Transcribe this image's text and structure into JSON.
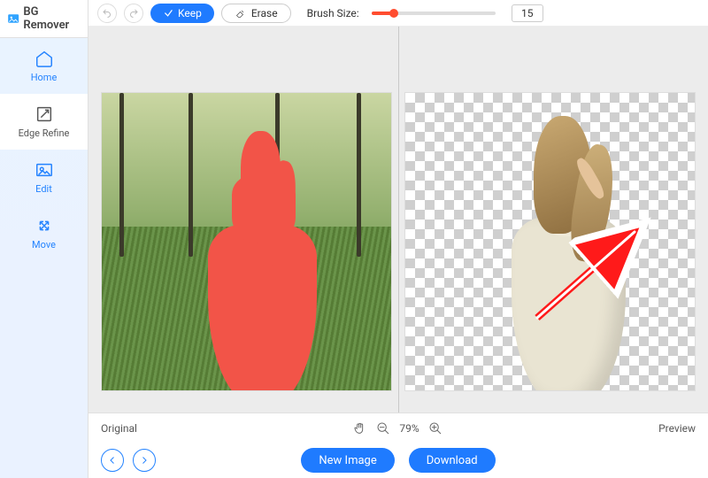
{
  "app_title": "BG Remover",
  "sidebar": {
    "items": [
      {
        "label": "Home",
        "icon": "home-icon"
      },
      {
        "label": "Edge Refine",
        "icon": "edge-refine-icon"
      },
      {
        "label": "Edit",
        "icon": "edit-icon"
      },
      {
        "label": "Move",
        "icon": "move-icon"
      }
    ],
    "active_index": 1
  },
  "toolbar": {
    "keep_label": "Keep",
    "erase_label": "Erase",
    "brush_label": "Brush Size:",
    "brush_value": "15"
  },
  "controls": {
    "left_label": "Original",
    "right_label": "Preview",
    "zoom_percent": "79%"
  },
  "bottom": {
    "new_image_label": "New Image",
    "download_label": "Download"
  }
}
